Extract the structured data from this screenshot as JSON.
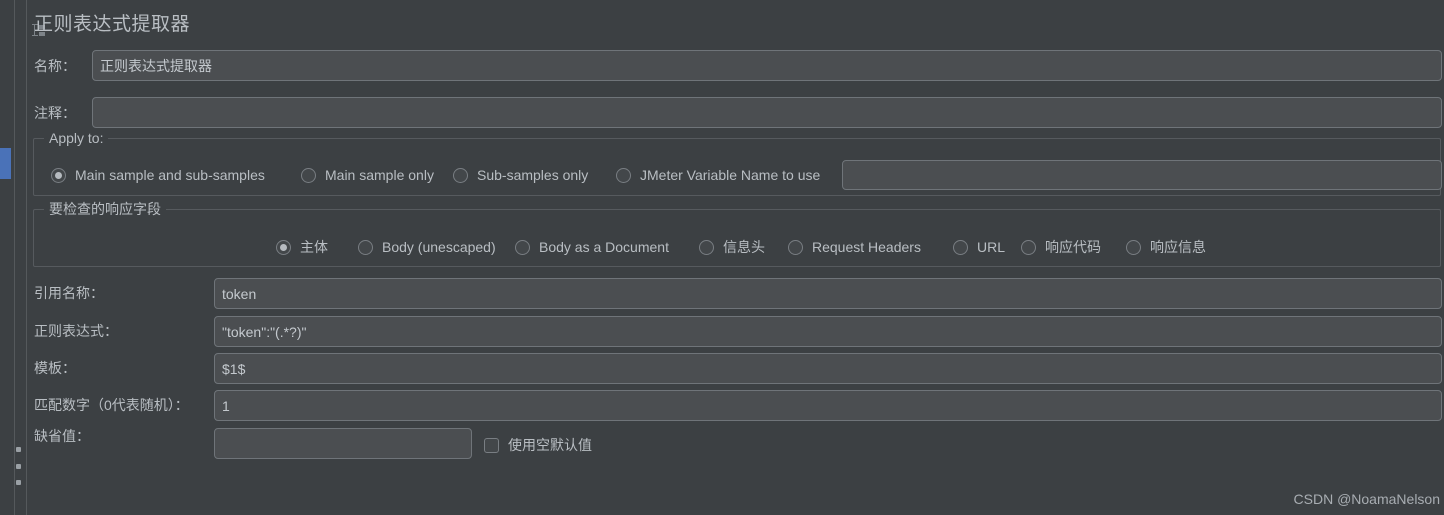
{
  "window": {
    "title": "正则表达式提取器",
    "accent_blue": "#4a72b8",
    "background": "#3c4043",
    "input_background": "#4b4e51",
    "text_color": "#b9bec3"
  },
  "form": {
    "name": {
      "label": "名称：",
      "value": "正则表达式提取器"
    },
    "comment": {
      "label": "注释：",
      "value": ""
    },
    "reference_name": {
      "label": "引用名称：",
      "value": "token"
    },
    "regex": {
      "label": "正则表达式：",
      "value": "\"token\":\"(.*?)\""
    },
    "template": {
      "label": "模板：",
      "value": "$1$"
    },
    "match_no": {
      "label": "匹配数字（0代表随机）：",
      "value": "1"
    },
    "default_value": {
      "label": "缺省值：",
      "value": ""
    },
    "use_empty_default": {
      "label": "使用空默认值",
      "checked": false
    }
  },
  "apply_to": {
    "legend": "Apply to:",
    "options": [
      {
        "label": "Main sample and sub-samples",
        "checked": false
      },
      {
        "label": "Main sample only",
        "checked": true
      },
      {
        "label": "Sub-samples only",
        "checked": false
      },
      {
        "label": "JMeter Variable Name to use",
        "checked": false
      }
    ],
    "variable_name_value": ""
  },
  "response_field": {
    "legend": "要检查的响应字段",
    "options": [
      {
        "label": "主体",
        "checked": true
      },
      {
        "label": "Body (unescaped)",
        "checked": false
      },
      {
        "label": "Body as a Document",
        "checked": false
      },
      {
        "label": "信息头",
        "checked": false
      },
      {
        "label": "Request Headers",
        "checked": false
      },
      {
        "label": "URL",
        "checked": false
      },
      {
        "label": "响应代码",
        "checked": false
      },
      {
        "label": "响应信息",
        "checked": false
      }
    ]
  },
  "watermark": {
    "text": "CSDN @NoamaNelson"
  }
}
